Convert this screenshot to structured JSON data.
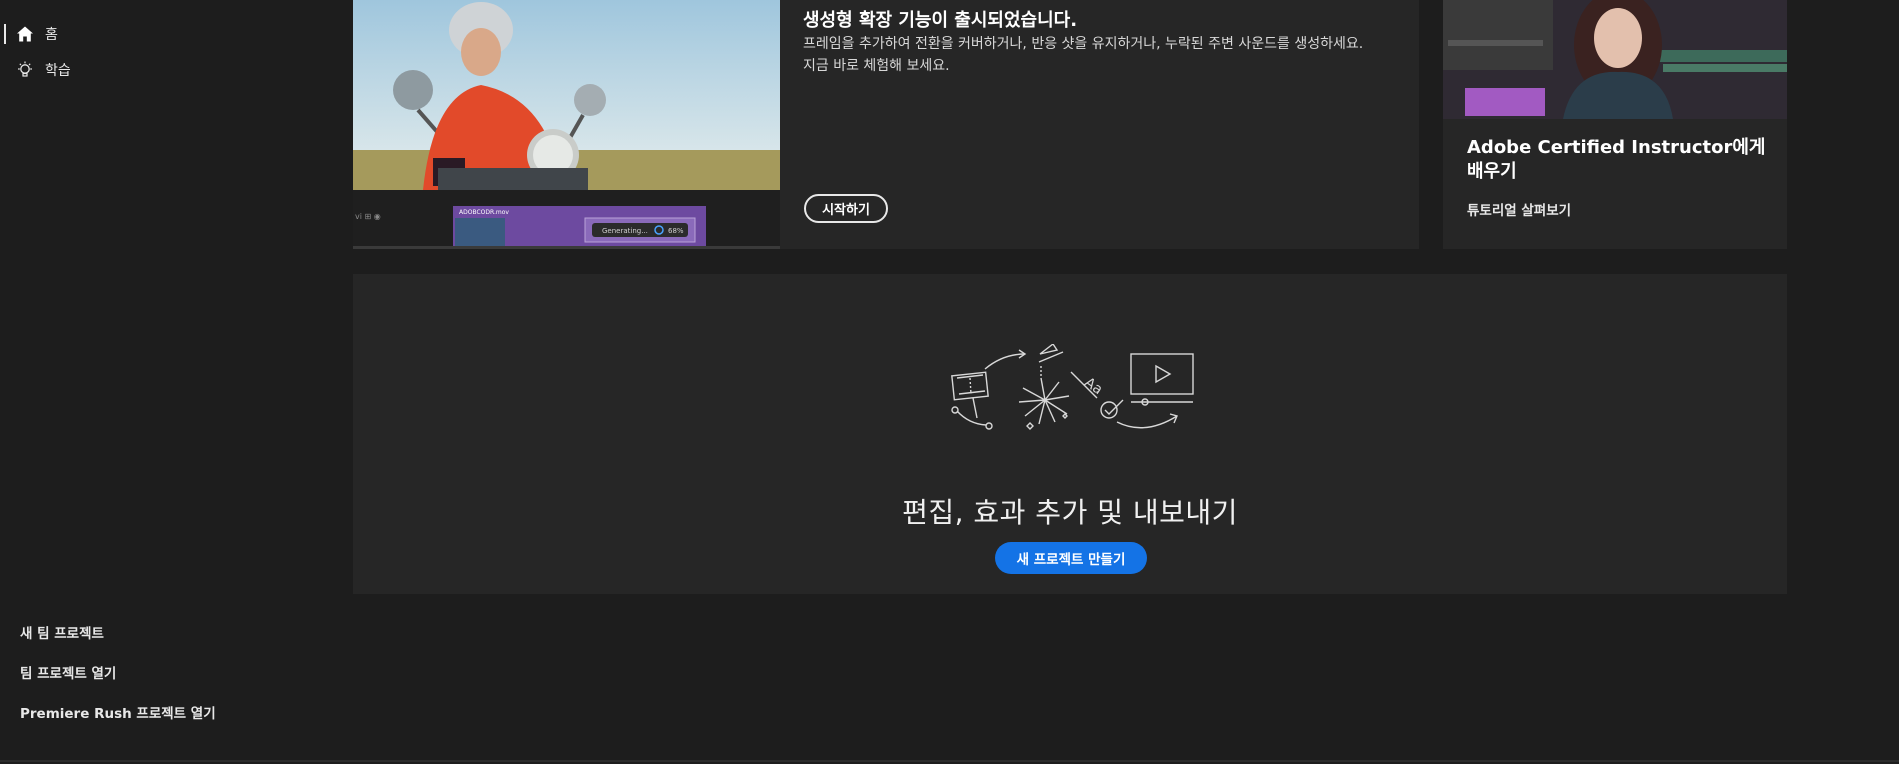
{
  "sidebar": {
    "nav": [
      {
        "label": "홈",
        "icon": "home-icon",
        "active": true
      },
      {
        "label": "학습",
        "icon": "lightbulb-icon",
        "active": false
      }
    ],
    "links": [
      "새 팀 프로젝트",
      "팀 프로젝트 열기",
      "Premiere Rush 프로젝트 열기"
    ]
  },
  "hero": {
    "title": "생성형 확장 기능이 출시되었습니다.",
    "desc_line1": "프레임을 추가하여 전환을 커버하거나, 반응 샷을 유지하거나, 누락된 주변 사운드를 생성하세요.",
    "desc_line2": "지금 바로 체험해 보세요.",
    "button": "시작하기",
    "media": {
      "clip_name": "ADOBCODR.mov",
      "status": "Generating...",
      "progress_label": "68%",
      "progress": 0.68
    }
  },
  "right_card": {
    "title": "Adobe Certified Instructor에게 배우기",
    "link": "튜토리얼 살펴보기"
  },
  "empty_state": {
    "title": "편집, 효과 추가 및 내보내기",
    "button": "새 프로젝트 만들기"
  },
  "colors": {
    "background": "#1d1d1d",
    "card": "#262626",
    "accent": "#1473e6"
  }
}
